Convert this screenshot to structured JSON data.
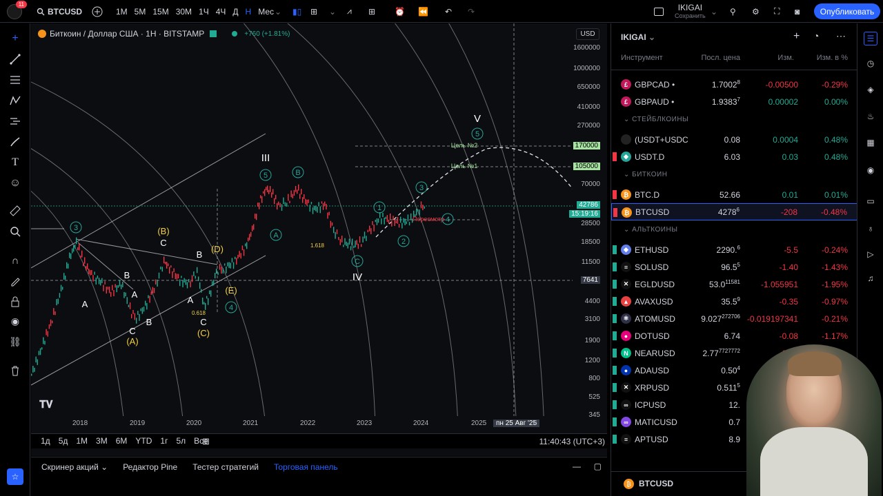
{
  "topbar": {
    "badge": "11",
    "symbol": "BTCUSD",
    "intervals": [
      "1М",
      "5М",
      "15М",
      "30М",
      "1Ч",
      "4Ч",
      "Д",
      "Н",
      "Мес"
    ],
    "active_interval": "Н",
    "layout_name": "IKIGAI",
    "layout_sub": "Сохранить",
    "publish": "Опубликовать"
  },
  "chart": {
    "title": "Биткоин / Доллар США · 1Н · BITSTAMP",
    "change": "+760 (+1.81%)",
    "currency": "USD",
    "price_ticks": [
      "1600000",
      "1000000",
      "650000",
      "410000",
      "270000",
      "170000",
      "105000",
      "70000",
      "42786",
      "28500",
      "18500",
      "11500",
      "7641",
      "4400",
      "3100",
      "1900",
      "1200",
      "800",
      "525",
      "345"
    ],
    "time_labels": [
      "2018",
      "2019",
      "2020",
      "2021",
      "2022",
      "2023",
      "2024",
      "2025",
      "пн 25 Авг '25",
      "6"
    ],
    "target1": "Цель №1",
    "target2": "Цель №2",
    "target1_price": "105000",
    "target2_price": "170000",
    "current_price": "42786",
    "countdown": "15:19:16",
    "crosshair_price": "7641",
    "fib_label1": "1.618",
    "fib_label2": "0.618",
    "recount": "Пересмотр",
    "waves": {
      "III": "III",
      "IV": "IV",
      "V": "V",
      "n1": "1",
      "n2": "2",
      "n3": "3",
      "n4": "4",
      "n5": "5",
      "A": "A",
      "B": "B",
      "C": "C",
      "D": "(D)",
      "E": "(E)",
      "Ap": "(A)",
      "Bp": "(B)",
      "Cp": "(C)"
    }
  },
  "timebar": {
    "ranges": [
      "1д",
      "5д",
      "1М",
      "3М",
      "6М",
      "YTD",
      "1г",
      "5л",
      "Все"
    ],
    "clock": "11:40:43 (UTC+3)"
  },
  "bottom_tabs": [
    "Скринер акций",
    "Редактор Pine",
    "Тестер стратегий",
    "Торговая панель"
  ],
  "watchlist": {
    "title": "IKIGAI",
    "headers": {
      "instrument": "Инструмент",
      "last": "Посл. цена",
      "chg": "Изм.",
      "pct": "Изм. в %"
    },
    "rows": [
      {
        "sym": "GBPCAD",
        "price": "1.7002",
        "sup": "8",
        "chg": "-0.00500",
        "pct": "-0.29%",
        "dir": "neg",
        "ic": "£",
        "icbg": "#c2185b",
        "flag": "#000"
      },
      {
        "sym": "GBPAUD",
        "price": "1.9383",
        "sup": "7",
        "chg": "0.00002",
        "pct": "0.00%",
        "dir": "pos",
        "ic": "£",
        "icbg": "#c2185b",
        "flag": "#000"
      },
      {
        "section": "СТЕЙБЛКОИНЫ"
      },
      {
        "sym": "(USDT+USDC",
        "price": "0.08",
        "sup": "",
        "chg": "0.0004",
        "pct": "0.48%",
        "dir": "pos",
        "pricecol": "neg",
        "ic": "",
        "icbg": "#222",
        "flag": "#000"
      },
      {
        "sym": "USDT.D",
        "price": "6.03",
        "sup": "",
        "chg": "0.03",
        "pct": "0.48%",
        "dir": "pos",
        "pricecol": "neg",
        "ic": "◆",
        "icbg": "#26a69a",
        "flag": "#f23645"
      },
      {
        "section": "БИТКОИН"
      },
      {
        "sym": "BTC.D",
        "price": "52.66",
        "sup": "",
        "chg": "0.01",
        "pct": "0.01%",
        "dir": "pos",
        "pricecol": "neg",
        "ic": "₿",
        "icbg": "#f7931a",
        "flag": "#f23645"
      },
      {
        "sym": "BTCUSD",
        "price": "4278",
        "sup": "6",
        "chg": "-208",
        "pct": "-0.48%",
        "dir": "neg",
        "ic": "₿",
        "icbg": "#f7931a",
        "flag": "#f23645",
        "selected": true
      },
      {
        "section": "АЛЬТКОИНЫ"
      },
      {
        "sym": "ETHUSD",
        "price": "2290.",
        "sup": "6",
        "chg": "-5.5",
        "pct": "-0.24%",
        "dir": "neg",
        "ic": "◆",
        "icbg": "#627eea",
        "flag": "#22ab94"
      },
      {
        "sym": "SOLUSD",
        "price": "96.5",
        "sup": "5",
        "chg": "-1.40",
        "pct": "-1.43%",
        "dir": "neg",
        "ic": "≡",
        "icbg": "#111",
        "flag": "#22ab94"
      },
      {
        "sym": "EGLDUSD",
        "price": "53.0",
        "sup": "11581",
        "chg": "-1.055951",
        "pct": "-1.95%",
        "dir": "neg",
        "ic": "✕",
        "icbg": "#111",
        "flag": "#22ab94"
      },
      {
        "sym": "AVAXUSD",
        "price": "35.5",
        "sup": "9",
        "chg": "-0.35",
        "pct": "-0.97%",
        "dir": "neg",
        "ic": "▲",
        "icbg": "#e84142",
        "flag": "#22ab94"
      },
      {
        "sym": "ATOMUSD",
        "price": "9.027",
        "sup": "272706",
        "chg": "-0.019197341",
        "pct": "-0.21%",
        "dir": "neg",
        "ic": "⚛",
        "icbg": "#2e3148",
        "flag": "#22ab94"
      },
      {
        "sym": "DOTUSD",
        "price": "6.74",
        "sup": "",
        "chg": "-0.08",
        "pct": "-1.17%",
        "dir": "neg",
        "ic": "●",
        "icbg": "#e6007a",
        "flag": "#22ab94"
      },
      {
        "sym": "NEARUSD",
        "price": "2.77",
        "sup": "7727772",
        "chg": "-0.03",
        "pct": "",
        "dir": "neg",
        "ic": "N",
        "icbg": "#00c08b",
        "flag": "#22ab94"
      },
      {
        "sym": "ADAUSD",
        "price": "0.50",
        "sup": "4",
        "chg": "",
        "pct": "",
        "dir": "neg",
        "ic": "●",
        "icbg": "#0033ad",
        "flag": "#22ab94"
      },
      {
        "sym": "XRPUSD",
        "price": "0.511",
        "sup": "5",
        "chg": "",
        "pct": "",
        "dir": "neg",
        "ic": "✕",
        "icbg": "#111",
        "flag": "#22ab94"
      },
      {
        "sym": "ICPUSD",
        "price": "12.",
        "sup": "",
        "chg": "",
        "pct": "",
        "dir": "neg",
        "ic": "∞",
        "icbg": "#111",
        "flag": "#22ab94"
      },
      {
        "sym": "MATICUSD",
        "price": "0.7",
        "sup": "",
        "chg": "",
        "pct": "",
        "dir": "neg",
        "ic": "∞",
        "icbg": "#8247e5",
        "flag": "#22ab94"
      },
      {
        "sym": "APTUSD",
        "price": "8.9",
        "sup": "",
        "chg": "",
        "pct": "",
        "dir": "neg",
        "ic": "≡",
        "icbg": "#111",
        "flag": "#22ab94"
      }
    ],
    "footer_symbol": "BTCUSD"
  }
}
